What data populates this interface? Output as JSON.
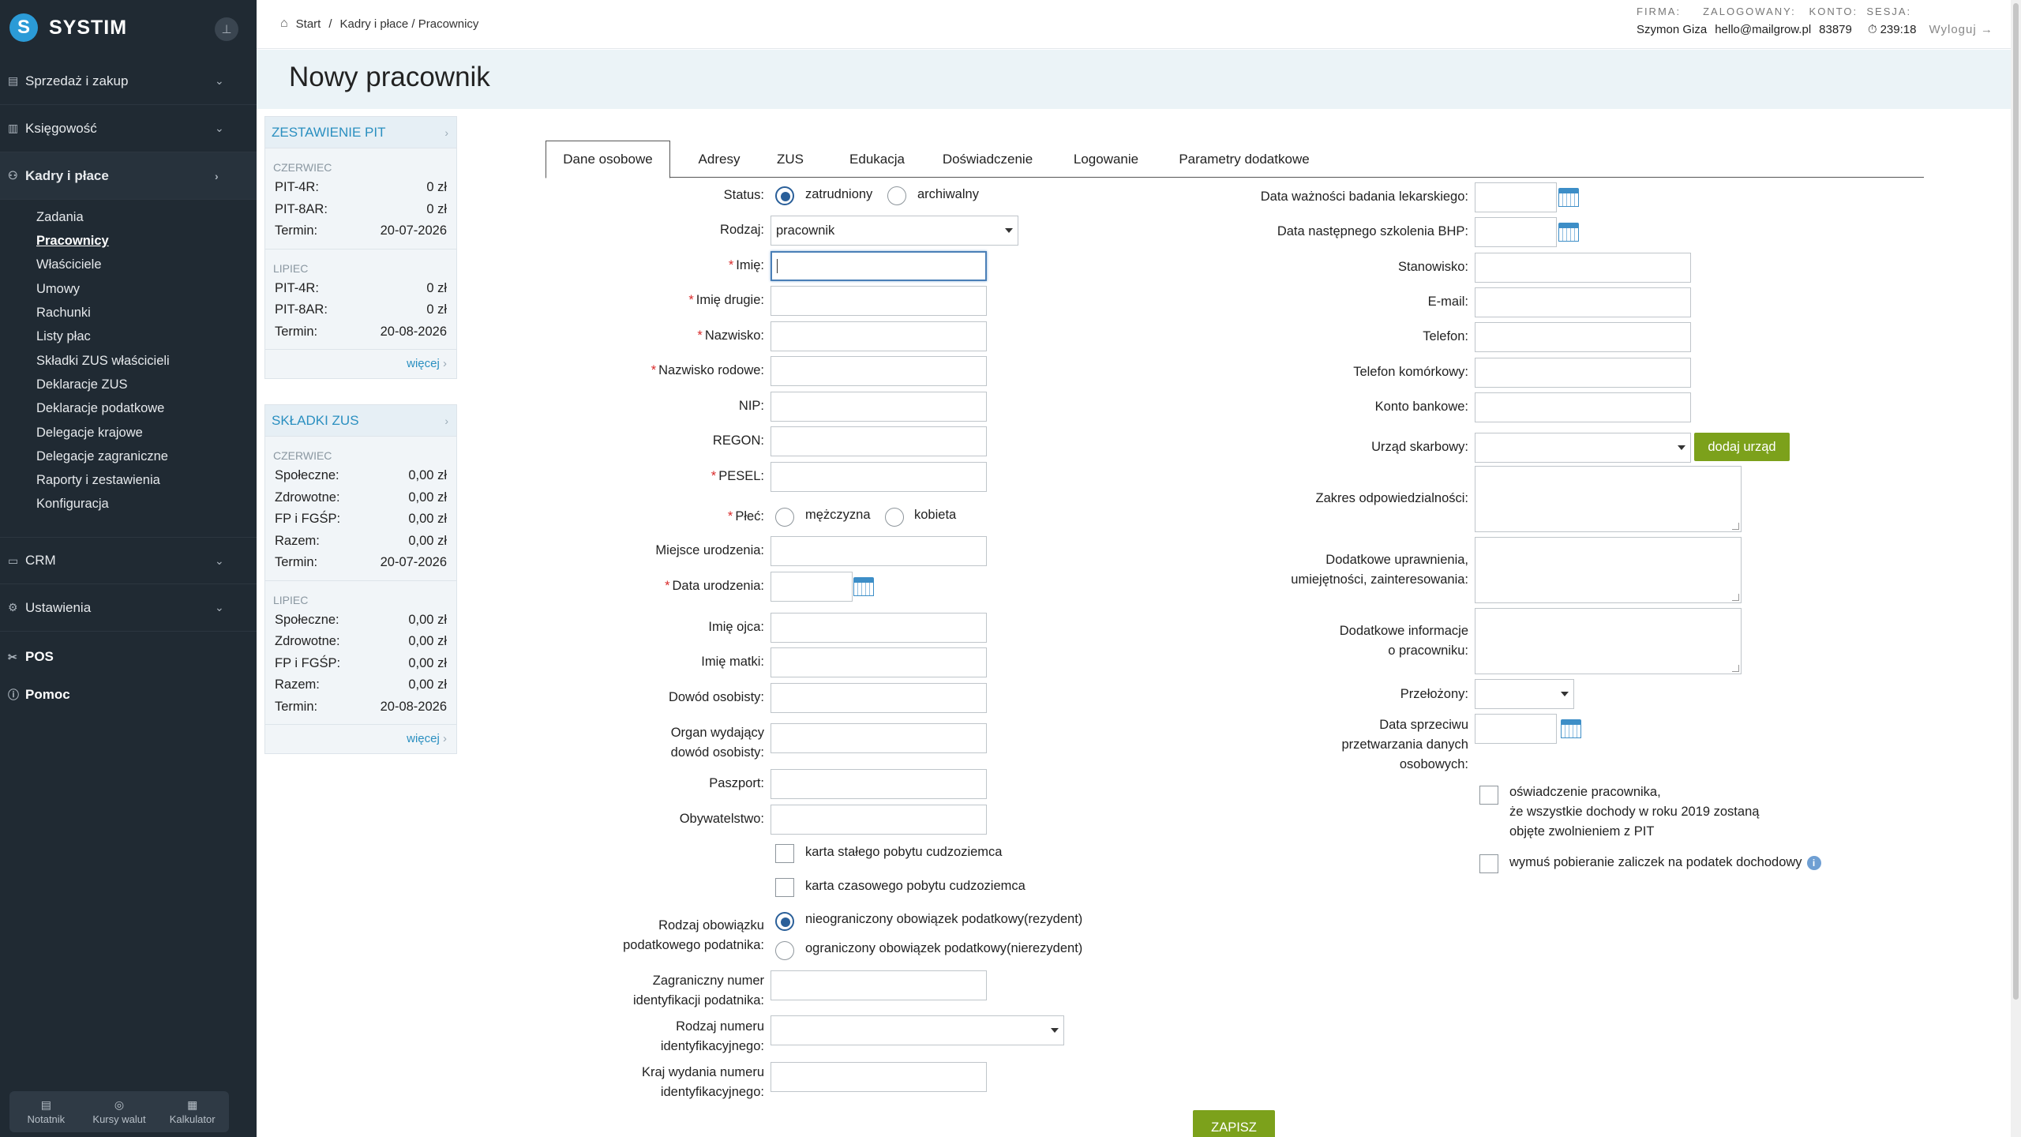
{
  "sidebar": {
    "brand": "SYSTIM",
    "logo_letter": "S",
    "menu": [
      {
        "label": "Sprzedaż i zakup"
      },
      {
        "label": "Księgowość"
      },
      {
        "label": "Kadry i płace"
      },
      {
        "label": "CRM"
      },
      {
        "label": "Ustawienia"
      }
    ],
    "submenu": [
      "Zadania",
      "Pracownicy",
      "Właściciele",
      "Umowy",
      "Rachunki",
      "Listy płac",
      "Składki ZUS właścicieli",
      "Deklaracje ZUS",
      "Deklaracje podatkowe",
      "Delegacje krajowe",
      "Delegacje zagraniczne",
      "Raporty i zestawienia",
      "Konfiguracja"
    ],
    "pos": "POS",
    "help": "Pomoc",
    "tools": [
      "Notatnik",
      "Kursy walut",
      "Kalkulator"
    ]
  },
  "header": {
    "breadcrumb": [
      "Start",
      "Kadry i płace / Pracownicy"
    ],
    "labels": "FIRMA:     ZALOGOWANY:   KONTO:  SESJA:",
    "company": "Szymon Giza",
    "user": "hello@mailgrow.pl",
    "account": "83879",
    "session": "239:18",
    "logout": "Wyloguj →"
  },
  "page": {
    "title": "Nowy pracownik"
  },
  "widgets": {
    "pit": {
      "title": "ZESTAWIENIE PIT",
      "months": [
        {
          "month": "CZERWIEC",
          "rows": [
            [
              "PIT-4R:",
              "0 zł"
            ],
            [
              "PIT-8AR:",
              "0 zł"
            ],
            [
              "Termin:",
              "20-07-2026"
            ]
          ]
        },
        {
          "month": "LIPIEC",
          "rows": [
            [
              "PIT-4R:",
              "0 zł"
            ],
            [
              "PIT-8AR:",
              "0 zł"
            ],
            [
              "Termin:",
              "20-08-2026"
            ]
          ]
        }
      ],
      "more": "więcej"
    },
    "zus": {
      "title": "SKŁADKI ZUS",
      "months": [
        {
          "month": "CZERWIEC",
          "rows": [
            [
              "Społeczne:",
              "0,00 zł"
            ],
            [
              "Zdrowotne:",
              "0,00 zł"
            ],
            [
              "FP i FGŚP:",
              "0,00 zł"
            ],
            [
              "Razem:",
              "0,00 zł"
            ],
            [
              "Termin:",
              "20-07-2026"
            ]
          ]
        },
        {
          "month": "LIPIEC",
          "rows": [
            [
              "Społeczne:",
              "0,00 zł"
            ],
            [
              "Zdrowotne:",
              "0,00 zł"
            ],
            [
              "FP i FGŚP:",
              "0,00 zł"
            ],
            [
              "Razem:",
              "0,00 zł"
            ],
            [
              "Termin:",
              "20-08-2026"
            ]
          ]
        }
      ],
      "more": "więcej"
    }
  },
  "tabs": [
    "Dane osobowe",
    "Adresy",
    "ZUS",
    "Edukacja",
    "Doświadczenie",
    "Logowanie",
    "Parametry dodatkowe"
  ],
  "form": {
    "status_label": "Status:",
    "status_options": [
      "zatrudniony",
      "archiwalny"
    ],
    "rodzaj_label": "Rodzaj:",
    "rodzaj_value": "pracownik",
    "imie": "Imię:",
    "imie_drugie": "Imię drugie:",
    "nazwisko": "Nazwisko:",
    "nazwisko_rodowe": "Nazwisko rodowe:",
    "nip": "NIP:",
    "regon": "REGON:",
    "pesel": "PESEL:",
    "plec": "Płeć:",
    "plec_options": [
      "mężczyzna",
      "kobieta"
    ],
    "miejsce_urodzenia": "Miejsce urodzenia:",
    "data_urodzenia": "Data urodzenia:",
    "imie_ojca": "Imię ojca:",
    "imie_matki": "Imię matki:",
    "dowod": "Dowód osobisty:",
    "organ_1": "Organ wydający",
    "organ_2": "dowód osobisty:",
    "paszport": "Paszport:",
    "obywatelstwo": "Obywatelstwo:",
    "karta_stalego": "karta stałego pobytu cudzoziemca",
    "karta_czasowego": "karta czasowego pobytu cudzoziemca",
    "obowiazek_1": "Rodzaj obowiązku",
    "obowiazek_2": "podatkowego podatnika:",
    "obowiazek_options": [
      "nieograniczony obowiązek podatkowy(rezydent)",
      "ograniczony obowiązek podatkowy(nierezydent)"
    ],
    "zagr_1": "Zagraniczny numer",
    "zagr_2": "identyfikacji podatnika:",
    "rodzaj_nr_1": "Rodzaj numeru",
    "rodzaj_nr_2": "identyfikacyjnego:",
    "kraj_1": "Kraj wydania numeru",
    "kraj_2": "identyfikacyjnego:",
    "badanie": "Data ważności badania lekarskiego:",
    "bhp": "Data następnego szkolenia BHP:",
    "stanowisko": "Stanowisko:",
    "email": "E-mail:",
    "telefon": "Telefon:",
    "telefon_kom": "Telefon komórkowy:",
    "konto": "Konto bankowe:",
    "urzad": "Urząd skarbowy:",
    "dodaj_urzad": "dodaj urząd",
    "zakres": "Zakres odpowiedzialności:",
    "uprawnienia_1": "Dodatkowe uprawnienia,",
    "uprawnienia_2": "umiejętności, zainteresowania:",
    "info_1": "Dodatkowe informacje",
    "info_2": "o pracowniku:",
    "przelozony": "Przełożony:",
    "sprzeciw_1": "Data sprzeciwu",
    "sprzeciw_2": "przetwarzania danych",
    "sprzeciw_3": "osobowych:",
    "oswiadczenie_1": "oświadczenie pracownika,",
    "oswiadczenie_2": "że wszystkie dochody w roku 2019 zostaną",
    "oswiadczenie_3": "objęte zwolnieniem z PIT",
    "wymus": "wymuś pobieranie zaliczek na podatek dochodowy",
    "save": "ZAPISZ"
  }
}
